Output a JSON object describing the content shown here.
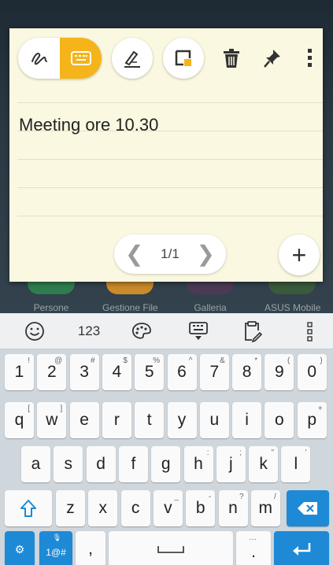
{
  "memo": {
    "toolbar": {
      "handwriting_icon": "handwriting-icon",
      "keyboard_icon": "keyboard-icon",
      "pen_style_icon": "pen-style-icon",
      "note_color_icon": "note-color-icon",
      "delete_icon": "trash-icon",
      "pin_icon": "pin-icon",
      "more_icon": "more-vertical-icon"
    },
    "text": "Meeting ore 10.30",
    "pager": {
      "label": "1/1"
    },
    "add_label": "+"
  },
  "home_apps": [
    {
      "label": "Persone"
    },
    {
      "label": "Gestione File"
    },
    {
      "label": "Galleria"
    },
    {
      "label": "ASUS Mobile"
    }
  ],
  "keyboard": {
    "toolbar": {
      "numbers_label": "123"
    },
    "row1": [
      {
        "k": "1",
        "h": "!"
      },
      {
        "k": "2",
        "h": "@"
      },
      {
        "k": "3",
        "h": "#"
      },
      {
        "k": "4",
        "h": "$"
      },
      {
        "k": "5",
        "h": "%"
      },
      {
        "k": "6",
        "h": "^"
      },
      {
        "k": "7",
        "h": "&"
      },
      {
        "k": "8",
        "h": "*"
      },
      {
        "k": "9",
        "h": "("
      },
      {
        "k": "0",
        "h": ")"
      }
    ],
    "row2": [
      {
        "k": "q",
        "h": "["
      },
      {
        "k": "w",
        "h": "]"
      },
      {
        "k": "e",
        "h": ""
      },
      {
        "k": "r",
        "h": ""
      },
      {
        "k": "t",
        "h": ""
      },
      {
        "k": "y",
        "h": ""
      },
      {
        "k": "u",
        "h": ""
      },
      {
        "k": "i",
        "h": ""
      },
      {
        "k": "o",
        "h": ""
      },
      {
        "k": "p",
        "h": "+"
      }
    ],
    "row3": [
      {
        "k": "a",
        "h": ""
      },
      {
        "k": "s",
        "h": ""
      },
      {
        "k": "d",
        "h": ""
      },
      {
        "k": "f",
        "h": ""
      },
      {
        "k": "g",
        "h": ""
      },
      {
        "k": "h",
        "h": ":"
      },
      {
        "k": "j",
        "h": ";"
      },
      {
        "k": "k",
        "h": "\""
      },
      {
        "k": "l",
        "h": "'"
      }
    ],
    "row4": [
      {
        "k": "z",
        "h": ""
      },
      {
        "k": "x",
        "h": ""
      },
      {
        "k": "c",
        "h": ""
      },
      {
        "k": "v",
        "h": "_"
      },
      {
        "k": "b",
        "h": "-"
      },
      {
        "k": "n",
        "h": "?"
      },
      {
        "k": "m",
        "h": "/"
      }
    ],
    "bottom": {
      "symbols_label": "1@#",
      "comma": ",",
      "period": ".",
      "period_hint": "…"
    },
    "accent_color": "#1e8ad6"
  }
}
